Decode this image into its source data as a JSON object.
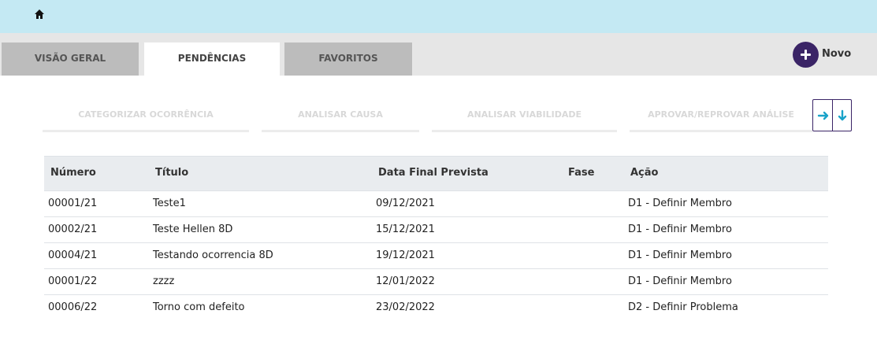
{
  "header": {
    "home_icon": "home-icon",
    "background": "#c4e9f3"
  },
  "tabs": [
    {
      "label": "VISÃO GERAL",
      "active": false
    },
    {
      "label": "PENDÊNCIAS",
      "active": true
    },
    {
      "label": "FAVORITOS",
      "active": false
    }
  ],
  "new_button": {
    "label": "Novo",
    "icon": "plus-circle-icon",
    "color": "#3a2466"
  },
  "phase_tabs": [
    {
      "label": "CATEGORIZAR OCORRÊNCIA"
    },
    {
      "label": "ANALISAR CAUSA"
    },
    {
      "label": "ANALISAR VIABILIDADE"
    },
    {
      "label": "APROVAR/REPROVAR ANÁLISE"
    }
  ],
  "nav_arrows": {
    "right_icon": "arrow-right-icon",
    "down_icon": "arrow-down-icon",
    "color": "#1aa3c9"
  },
  "table": {
    "columns": [
      "Número",
      "Título",
      "Data Final Prevista",
      "Fase",
      "Ação"
    ],
    "rows": [
      {
        "numero": "00001/21",
        "titulo": "Teste1",
        "data": "09/12/2021",
        "fase": "",
        "acao": "D1 - Definir Membro"
      },
      {
        "numero": "00002/21",
        "titulo": "Teste Hellen 8D",
        "data": "15/12/2021",
        "fase": "",
        "acao": "D1 - Definir Membro"
      },
      {
        "numero": "00004/21",
        "titulo": "Testando ocorrencia 8D",
        "data": "19/12/2021",
        "fase": "",
        "acao": "D1 - Definir Membro"
      },
      {
        "numero": "00001/22",
        "titulo": "zzzz",
        "data": "12/01/2022",
        "fase": "",
        "acao": "D1 - Definir Membro"
      },
      {
        "numero": "00006/22",
        "titulo": "Torno com defeito",
        "data": "23/02/2022",
        "fase": "",
        "acao": "D2 - Definir Problema"
      }
    ]
  }
}
